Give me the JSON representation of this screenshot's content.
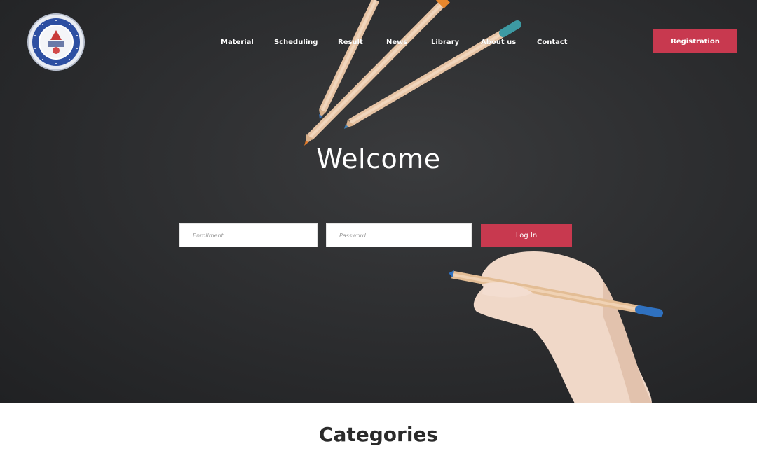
{
  "brand": {
    "logo_icon": "institute-seal-logo"
  },
  "nav": {
    "items": [
      {
        "label": "Material"
      },
      {
        "label": "Scheduling"
      },
      {
        "label": "Result"
      },
      {
        "label": "News"
      },
      {
        "label": "Library"
      },
      {
        "label": "About us"
      },
      {
        "label": "Contact"
      }
    ]
  },
  "header": {
    "registration_label": "Registration"
  },
  "hero": {
    "title": "Welcome",
    "enrollment_placeholder": "Enrollment",
    "password_placeholder": "Password",
    "login_label": "Log In"
  },
  "section": {
    "categories_title": "Categories"
  },
  "colors": {
    "accent": "#c8394f",
    "hero_background": "#2f3032",
    "nav_text": "#ffffff",
    "heading_text": "#2b2b2b"
  }
}
